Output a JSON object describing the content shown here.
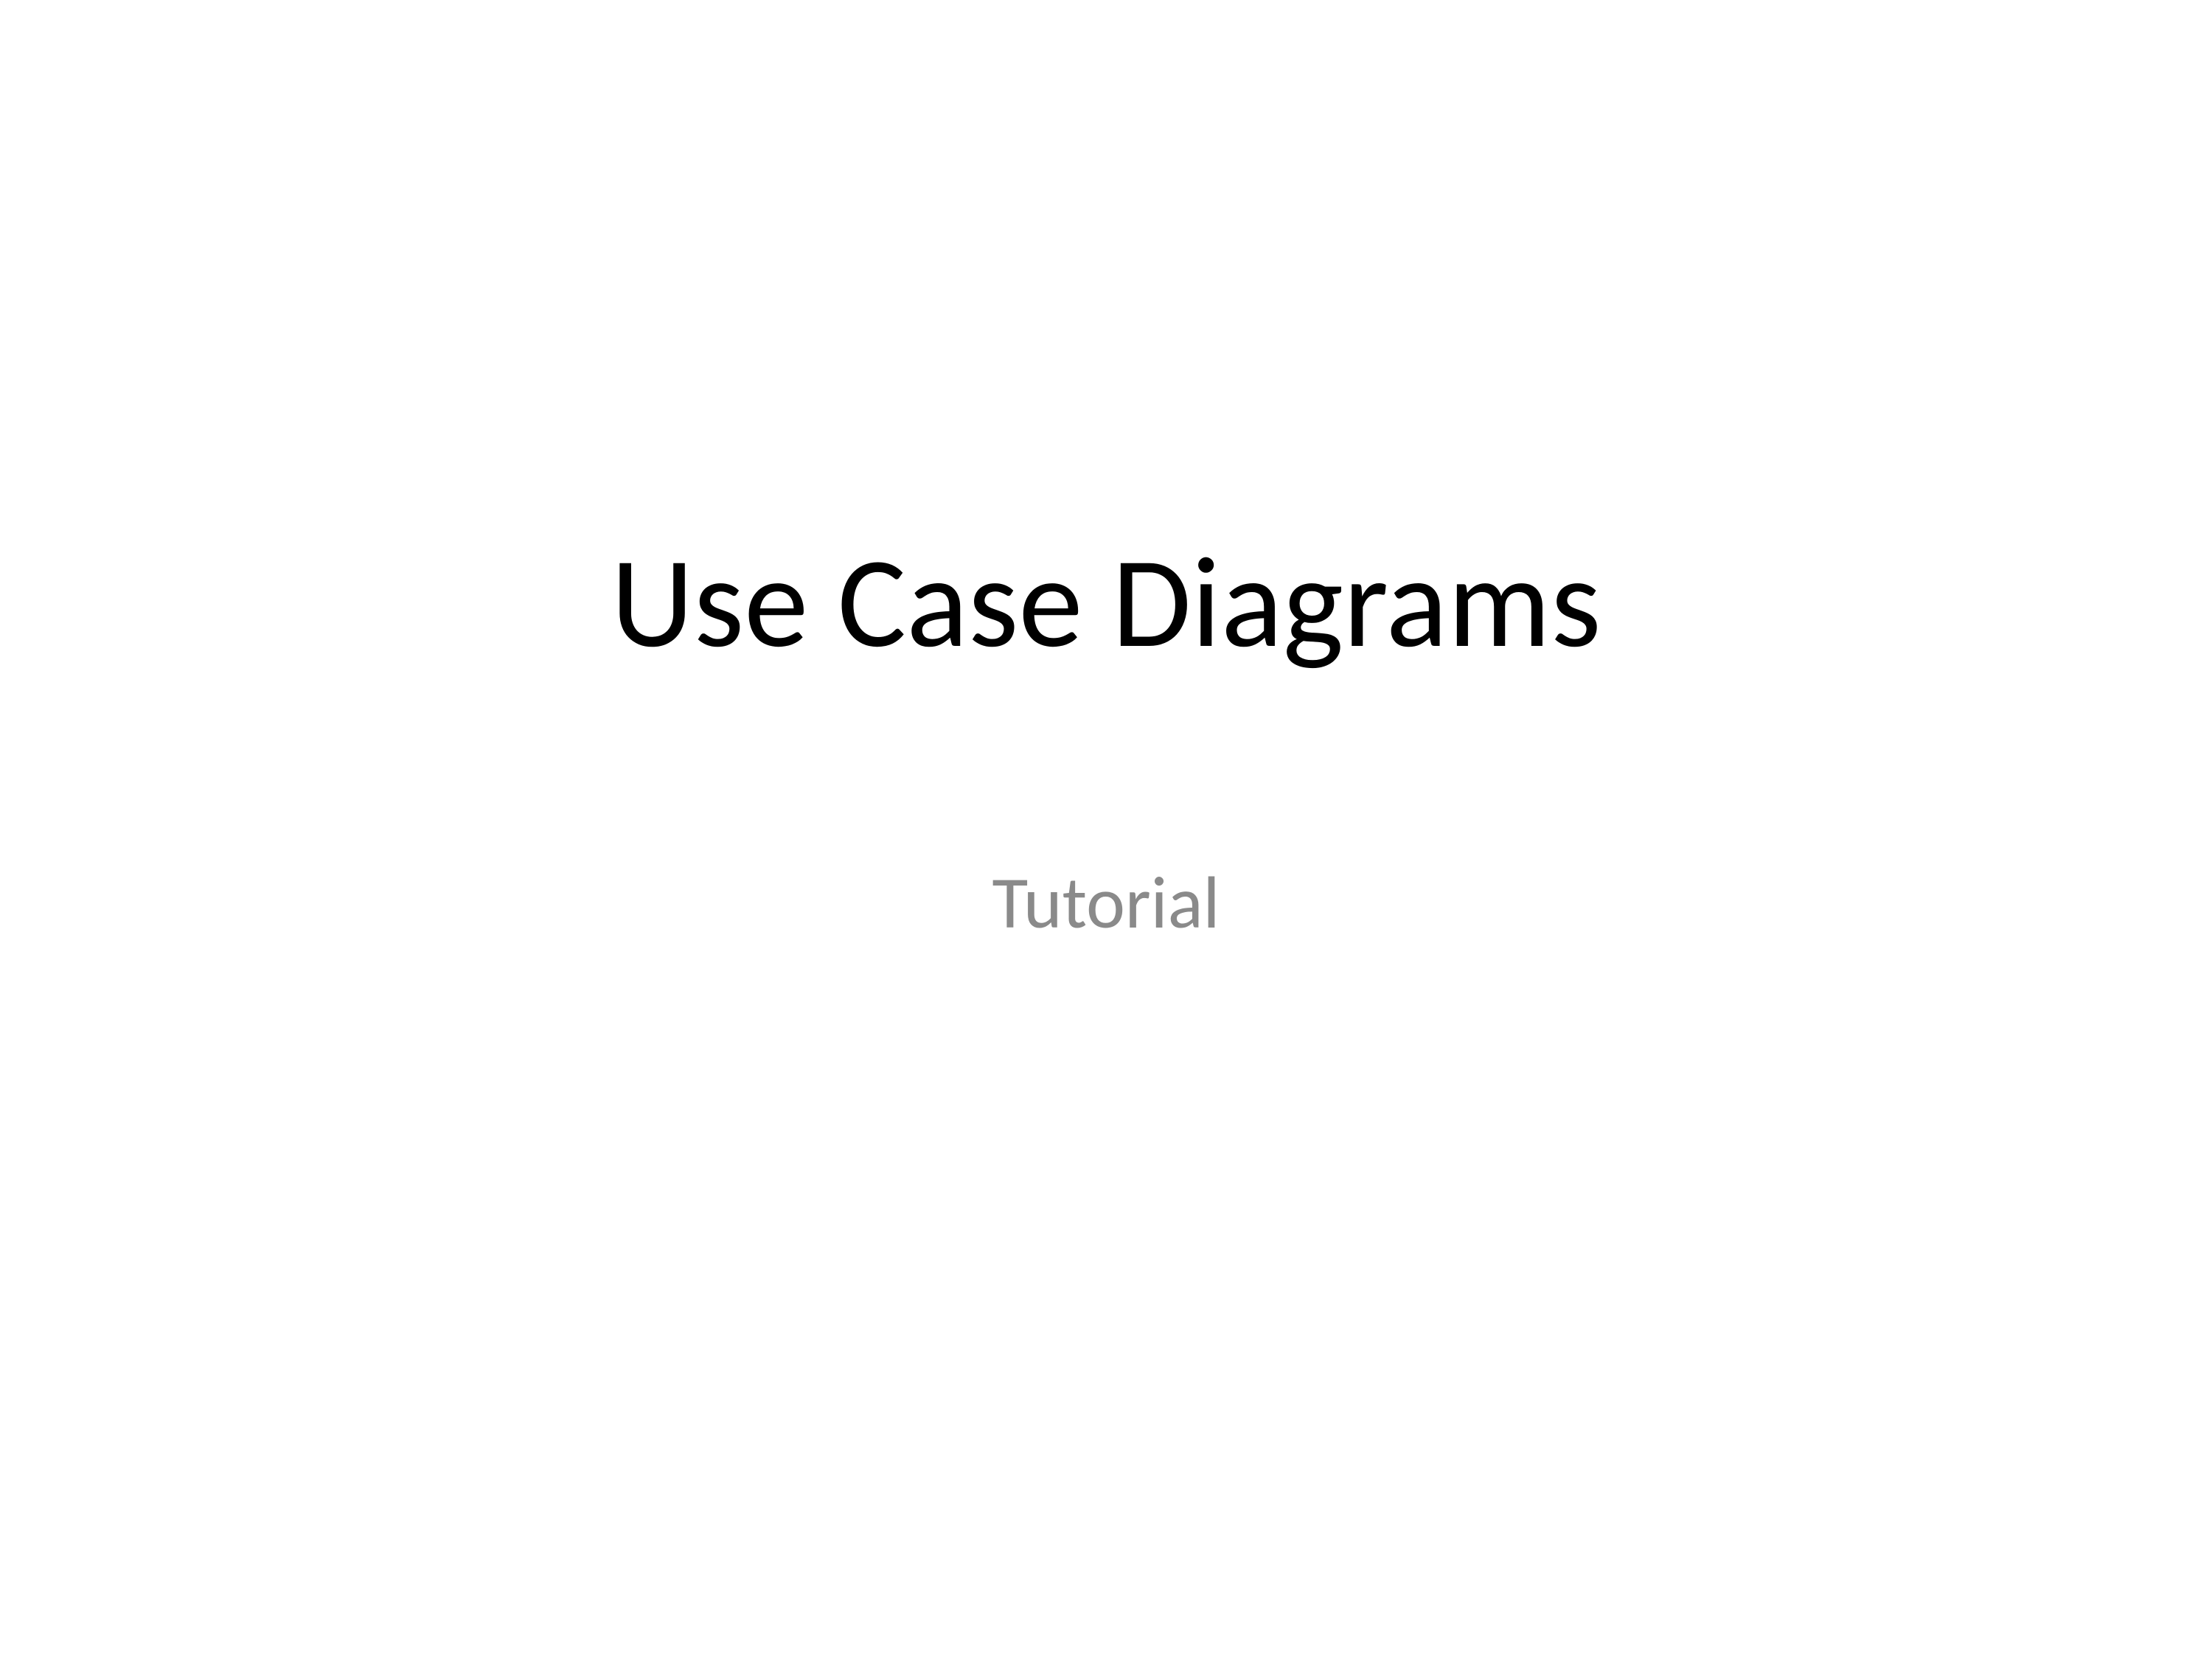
{
  "slide": {
    "title": "Use Case Diagrams",
    "subtitle": "Tutorial"
  }
}
